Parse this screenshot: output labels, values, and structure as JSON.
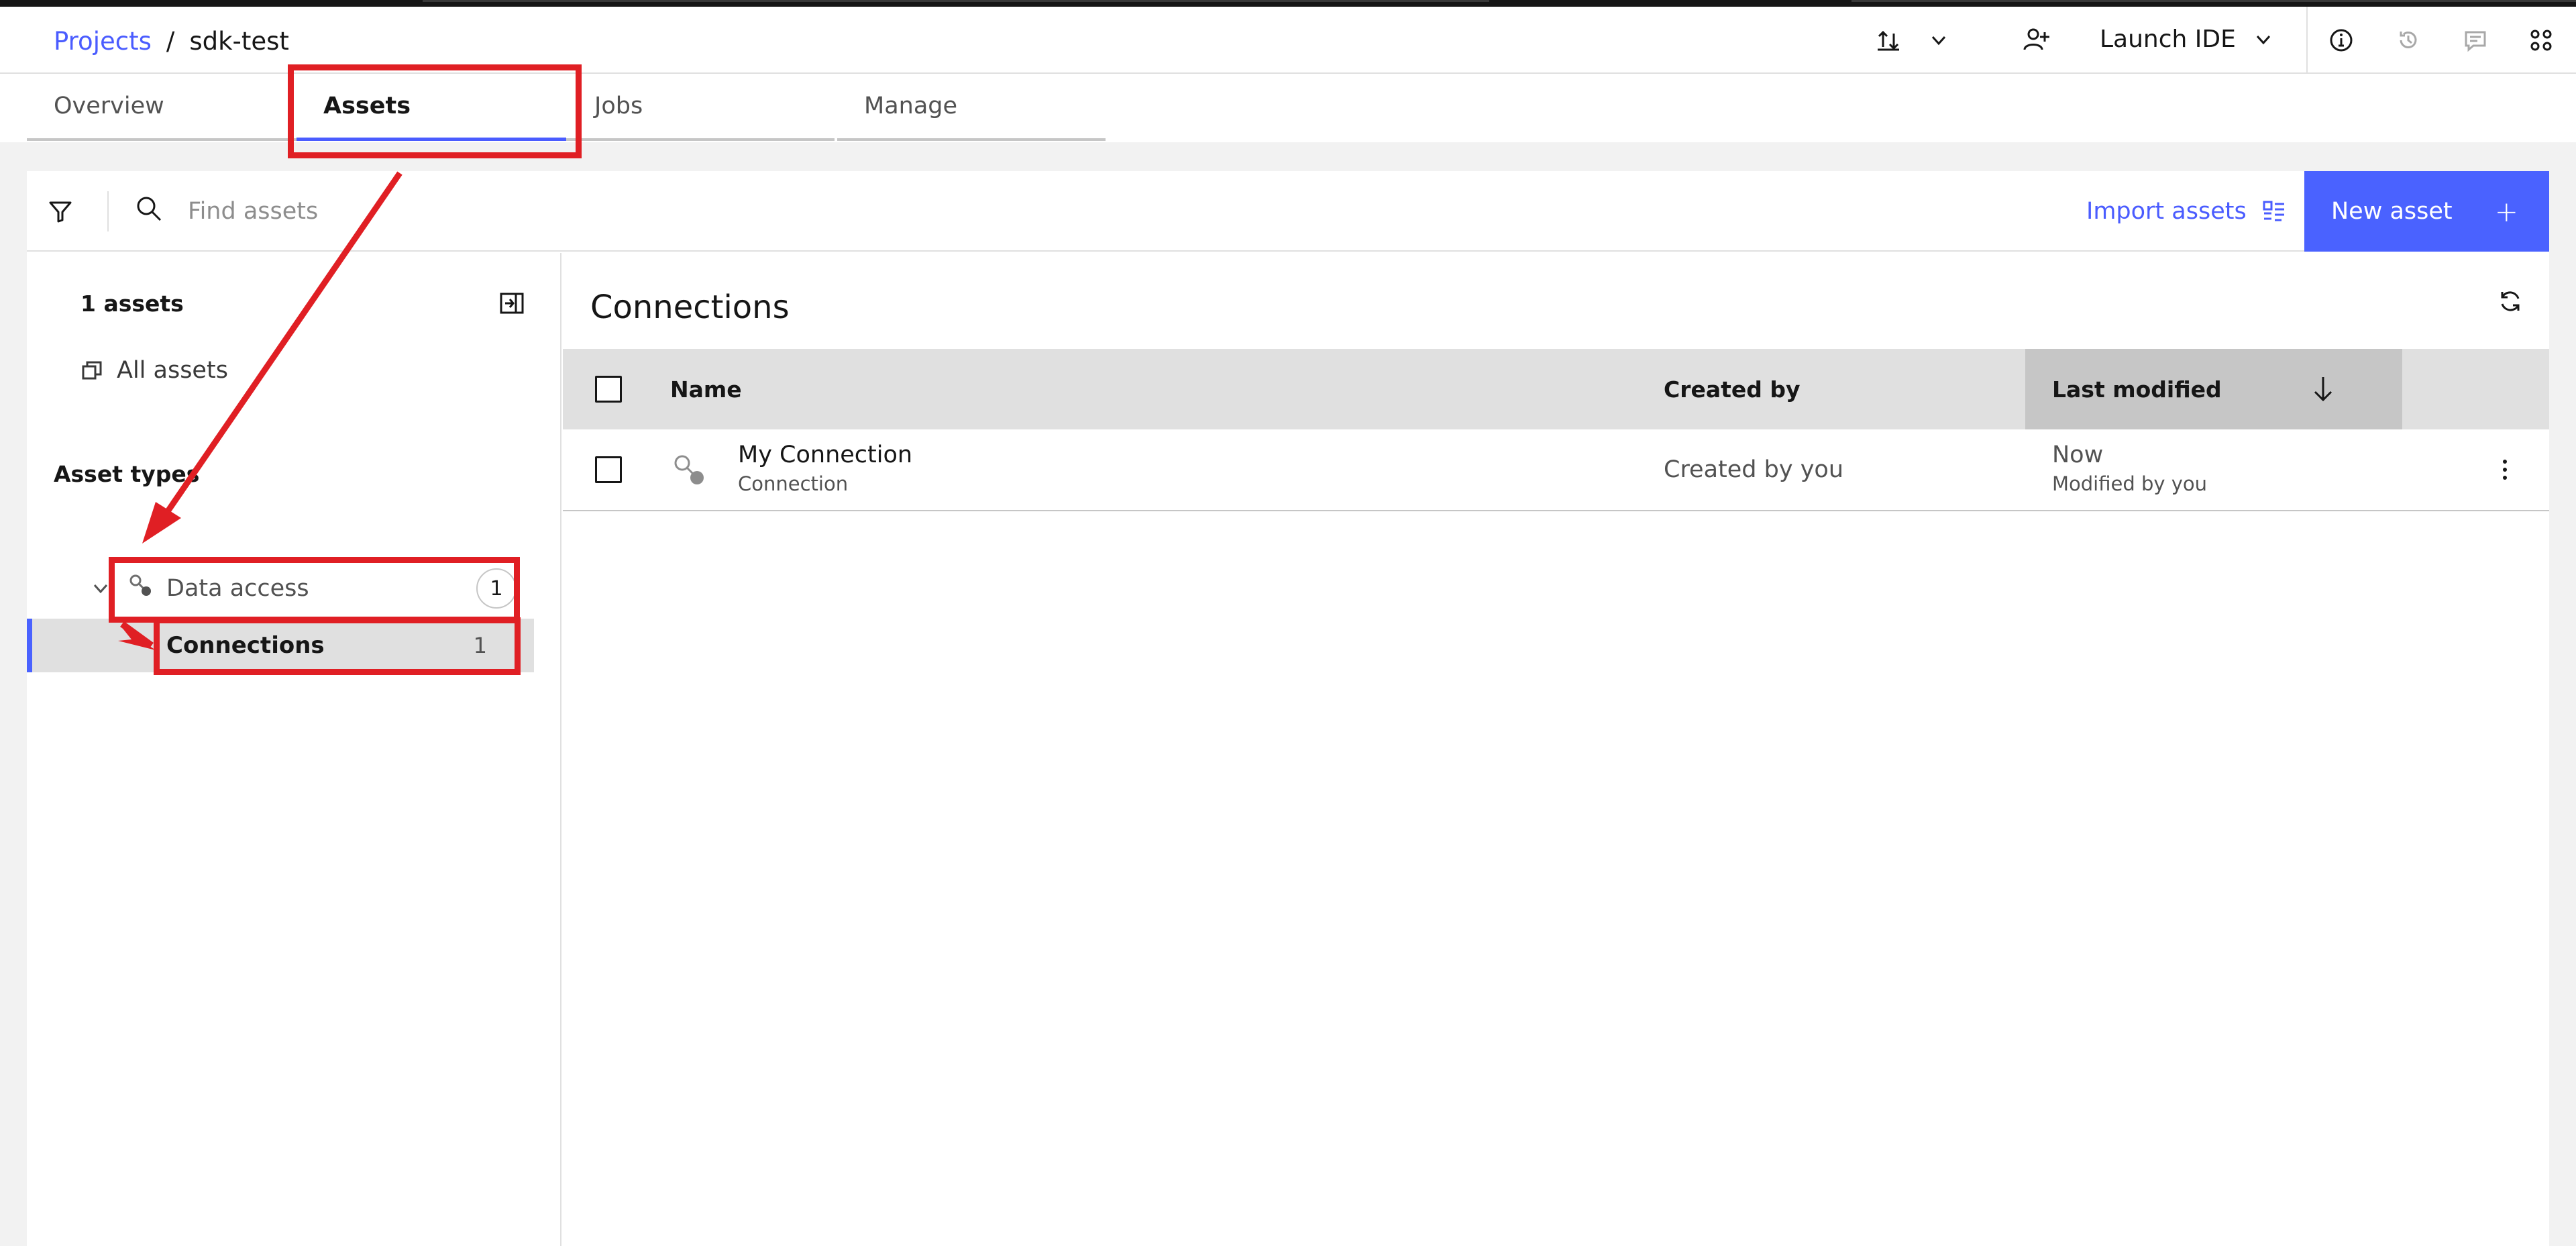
{
  "breadcrumb": {
    "parent": "Projects",
    "separator": "/",
    "current": "sdk-test"
  },
  "header": {
    "launch_ide": "Launch IDE"
  },
  "tabs": [
    {
      "label": "Overview"
    },
    {
      "label": "Assets"
    },
    {
      "label": "Jobs"
    },
    {
      "label": "Manage"
    }
  ],
  "toolbar": {
    "search_placeholder": "Find assets",
    "import_label": "Import assets",
    "new_asset_label": "New asset",
    "new_asset_plus": "+"
  },
  "sidebar": {
    "count_label": "1 assets",
    "all_assets_label": "All assets",
    "asset_types_heading": "Asset types",
    "tree": {
      "group_label": "Data access",
      "group_count": "1",
      "child_label": "Connections",
      "child_count": "1"
    }
  },
  "main": {
    "title": "Connections",
    "columns": {
      "name": "Name",
      "created_by": "Created by",
      "last_modified": "Last modified"
    },
    "rows": [
      {
        "name": "My Connection",
        "type": "Connection",
        "created_by": "Created by you",
        "modified": "Now",
        "modified_by": "Modified by you"
      }
    ]
  },
  "colors": {
    "accent": "#4a62ff",
    "link": "#4a5cff",
    "annotation": "#e01f24"
  }
}
